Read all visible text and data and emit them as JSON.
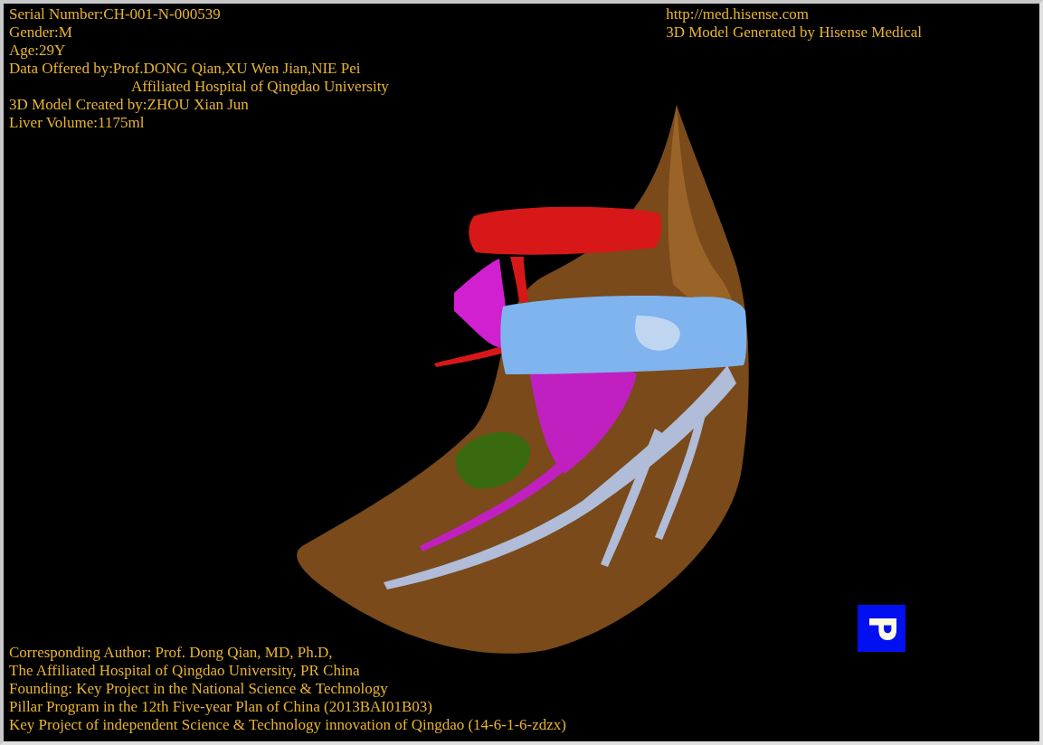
{
  "patient_info": [
    {
      "kind": "line",
      "text": "Serial Number:CH-001-N-000539"
    },
    {
      "kind": "line",
      "text": "Gender:M"
    },
    {
      "kind": "line",
      "text": "Age:29Y"
    },
    {
      "kind": "line",
      "text": "Data Offered by:Prof.DONG Qian,XU Wen Jian,NIE Pei"
    },
    {
      "kind": "continuation",
      "text": "Affiliated Hospital of Qingdao University"
    },
    {
      "kind": "line",
      "text": "3D Model Created by:ZHOU Xian Jun"
    },
    {
      "kind": "line",
      "text": "Liver Volume:1175ml"
    }
  ],
  "source_info": [
    {
      "kind": "line",
      "text": "http://med.hisense.com"
    },
    {
      "kind": "line",
      "text": "3D Model Generated by Hisense Medical"
    }
  ],
  "credits": [
    {
      "kind": "line",
      "text": "Corresponding Author: Prof. Dong Qian, MD, Ph.D,"
    },
    {
      "kind": "line",
      "text": "The Affiliated Hospital of Qingdao University, PR China"
    },
    {
      "kind": "line",
      "text": "Founding: Key Project in the National Science & Technology"
    },
    {
      "kind": "line",
      "text": "Pillar Program in the 12th Five-year Plan of China (2013BAI01B03)"
    },
    {
      "kind": "line",
      "text": "Key Project of independent Science & Technology innovation of Qingdao (14-6-1-6-zdzx)"
    }
  ],
  "orientation_marker": {
    "label": "P"
  }
}
